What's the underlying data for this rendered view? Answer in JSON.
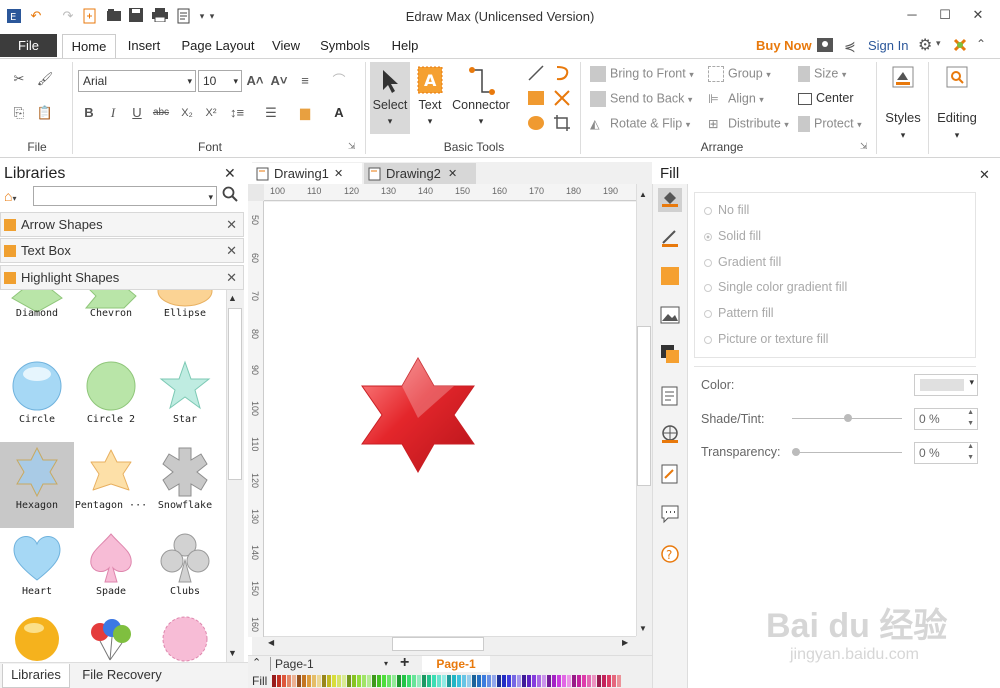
{
  "window": {
    "title": "Edraw Max (Unlicensed Version)",
    "min_glyph": "─",
    "max_glyph": "☐",
    "close_glyph": "✕"
  },
  "menu": {
    "file": "File",
    "tabs": [
      "Home",
      "Insert",
      "Page Layout",
      "View",
      "Symbols",
      "Help"
    ],
    "buy_now": "Buy Now",
    "sign_in": "Sign In"
  },
  "ribbon": {
    "groups": {
      "file": "File",
      "font": "Font",
      "basic_tools": "Basic Tools",
      "arrange": "Arrange"
    },
    "font_name": "Arial",
    "font_size": "10",
    "select": "Select",
    "text": "Text",
    "connector": "Connector",
    "arrange": {
      "bring_to_front": "Bring to Front",
      "send_to_back": "Send to Back",
      "rotate_flip": "Rotate & Flip",
      "group": "Group",
      "align": "Align",
      "distribute": "Distribute",
      "size": "Size",
      "center": "Center",
      "protect": "Protect"
    },
    "styles": "Styles",
    "editing": "Editing"
  },
  "libraries": {
    "title": "Libraries",
    "categories": [
      "Arrow Shapes",
      "Text Box",
      "Highlight Shapes"
    ],
    "shapes": [
      "Diamond",
      "Chevron",
      "Ellipse",
      "Circle",
      "Circle 2",
      "Star",
      "Hexagon",
      "Pentagon ···",
      "Snowflake",
      "Heart",
      "Spade",
      "Clubs"
    ],
    "bottom_tabs": [
      "Libraries",
      "File Recovery"
    ]
  },
  "canvas": {
    "tabs": [
      "Drawing1",
      "Drawing2"
    ],
    "ruler_h": [
      "100",
      "110",
      "120",
      "130",
      "140",
      "150",
      "160",
      "170",
      "180",
      "190"
    ],
    "ruler_v": [
      "50",
      "60",
      "70",
      "80",
      "90",
      "100",
      "110",
      "120",
      "130",
      "140",
      "150",
      "160"
    ],
    "page_select": "Page-1",
    "page_tab": "Page-1",
    "fill_label": "Fill"
  },
  "fill_panel": {
    "title": "Fill",
    "options": [
      "No fill",
      "Solid fill",
      "Gradient fill",
      "Single color gradient fill",
      "Pattern fill",
      "Picture or texture fill"
    ],
    "color_label": "Color:",
    "shade_label": "Shade/Tint:",
    "shade_value": "0 %",
    "transparency_label": "Transparency:",
    "transparency_value": "0 %"
  },
  "watermark": {
    "brand": "Bai du 经验",
    "url": "jingyan.baidu.com"
  },
  "colors": {
    "accent_orange": "#e8790c",
    "file_tab": "#3c3c3c",
    "star_red": "#e4262b"
  }
}
